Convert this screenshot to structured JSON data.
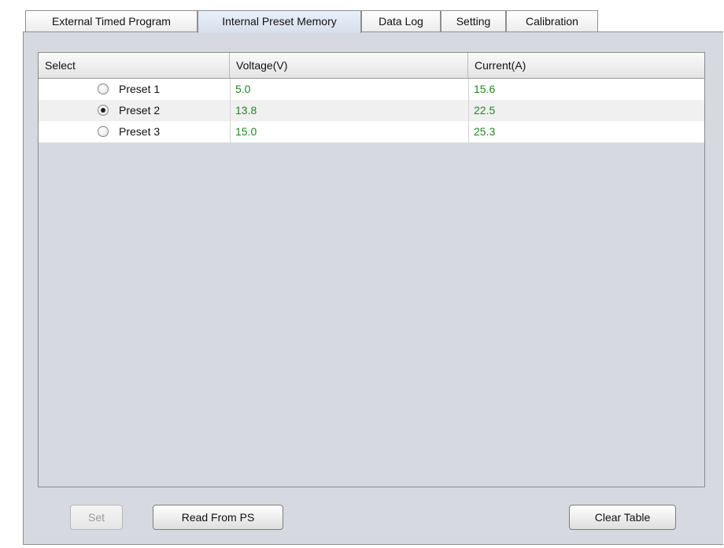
{
  "tabs": [
    {
      "label": "External Timed Program",
      "active": false
    },
    {
      "label": "Internal Preset Memory",
      "active": true
    },
    {
      "label": "Data Log",
      "active": false
    },
    {
      "label": "Setting",
      "active": false
    },
    {
      "label": "Calibration",
      "active": false
    }
  ],
  "table": {
    "columns": [
      "Select",
      "Voltage(V)",
      "Current(A)"
    ],
    "rows": [
      {
        "preset": "Preset 1",
        "selected": false,
        "voltage": "5.0",
        "current": "15.6"
      },
      {
        "preset": "Preset 2",
        "selected": true,
        "voltage": "13.8",
        "current": "22.5"
      },
      {
        "preset": "Preset 3",
        "selected": false,
        "voltage": "15.0",
        "current": "25.3"
      }
    ]
  },
  "buttons": {
    "set_label": "Set",
    "set_enabled": false,
    "read_label": "Read From PS",
    "clear_label": "Clear Table"
  },
  "colors": {
    "value_text": "#1d8a1d",
    "panel_bg": "#d6d9df",
    "active_tab_bg": "#d6dfea"
  }
}
